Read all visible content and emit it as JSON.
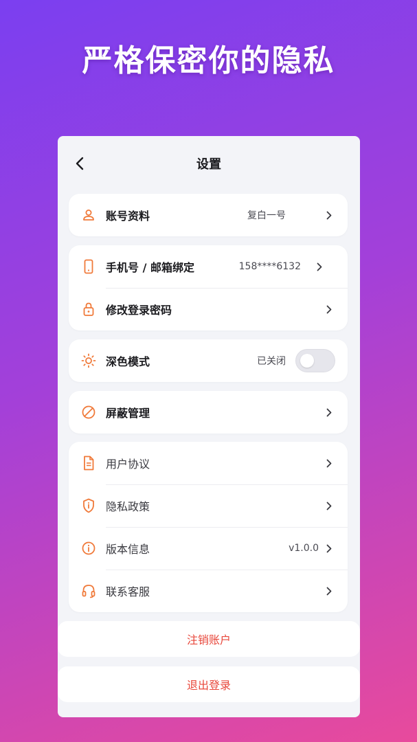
{
  "headline": "严格保密你的隐私",
  "nav": {
    "title": "设置"
  },
  "account": {
    "label": "账号资料",
    "value": "复白一号"
  },
  "binding": {
    "phone_label": "手机号 / 邮箱绑定",
    "phone_value": "158****6132",
    "password_label": "修改登录密码"
  },
  "dark_mode": {
    "label": "深色模式",
    "status": "已关闭",
    "enabled": false
  },
  "block": {
    "label": "屏蔽管理"
  },
  "info": {
    "agreement_label": "用户协议",
    "privacy_label": "隐私政策",
    "version_label": "版本信息",
    "version_value": "v1.0.0",
    "service_label": "联系客服"
  },
  "actions": {
    "deregister_label": "注销账户",
    "logout_label": "退出登录"
  },
  "colors": {
    "accent_icon": "#f07a3a",
    "danger_text": "#e8473b"
  },
  "icons": {
    "back": "chevron-left-icon",
    "account": "user-icon",
    "phone": "phone-icon",
    "password": "lock-icon",
    "dark_mode": "sun-icon",
    "block": "block-icon",
    "agreement": "document-icon",
    "privacy": "shield-icon",
    "version": "info-icon",
    "service": "headset-icon",
    "chevron": "chevron-right-icon"
  }
}
